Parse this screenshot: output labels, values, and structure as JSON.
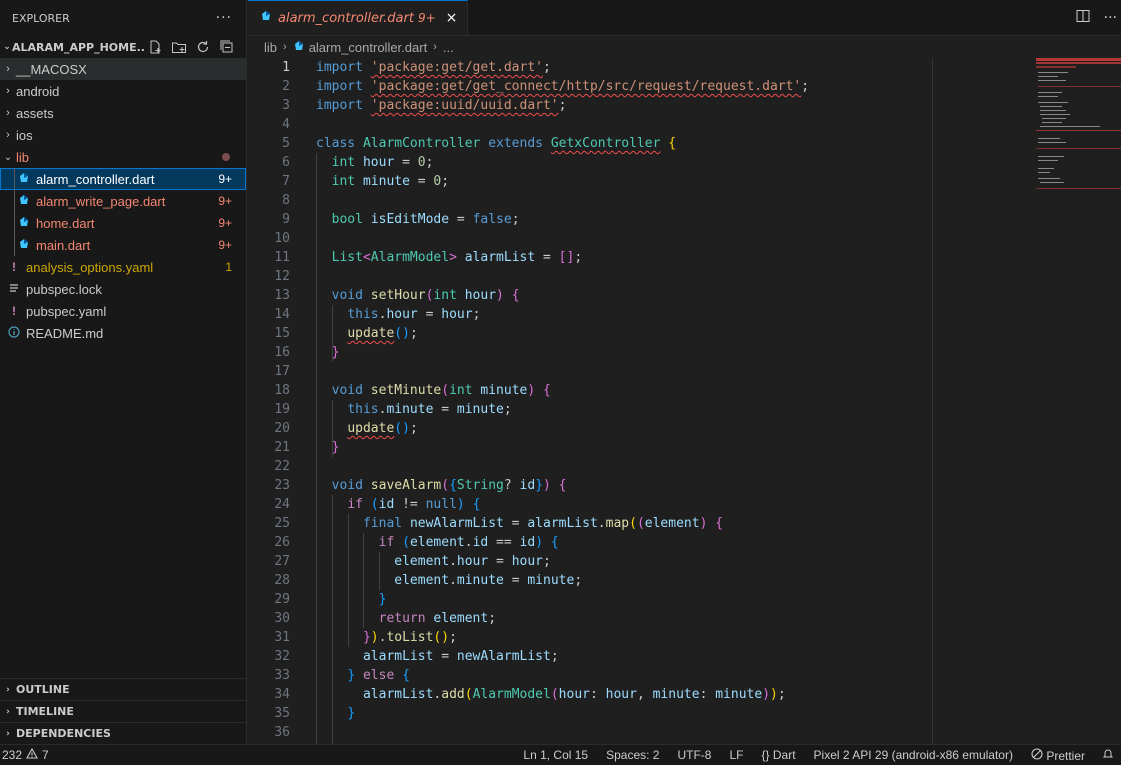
{
  "sidebar": {
    "header_title": "EXPLORER",
    "more": "···",
    "project_title": "ALARAM_APP_HOME...",
    "tree": [
      {
        "label": "__MACOSX",
        "type": "folder"
      },
      {
        "label": "android",
        "type": "folder"
      },
      {
        "label": "assets",
        "type": "folder"
      },
      {
        "label": "ios",
        "type": "folder"
      },
      {
        "label": "lib",
        "type": "folder-open"
      },
      {
        "label": "alarm_controller.dart",
        "badge": "9+"
      },
      {
        "label": "alarm_write_page.dart",
        "badge": "9+"
      },
      {
        "label": "home.dart",
        "badge": "9+"
      },
      {
        "label": "main.dart",
        "badge": "9+"
      },
      {
        "label": "analysis_options.yaml",
        "badge": "1"
      },
      {
        "label": "pubspec.lock"
      },
      {
        "label": "pubspec.yaml"
      },
      {
        "label": "README.md"
      }
    ],
    "sections": [
      "OUTLINE",
      "TIMELINE",
      "DEPENDENCIES"
    ]
  },
  "editor": {
    "tab_label": "alarm_controller.dart",
    "tab_badge": "9+",
    "tab_close": "×",
    "breadcrumb_folder": "lib",
    "breadcrumb_file": "alarm_controller.dart",
    "breadcrumb_more": "...",
    "line_numbers": [
      "1",
      "2",
      "3",
      "4",
      "5",
      "6",
      "7",
      "8",
      "9",
      "10",
      "11",
      "12",
      "13",
      "14",
      "15",
      "16",
      "17",
      "18",
      "19",
      "20",
      "21",
      "22",
      "23",
      "24",
      "25",
      "26",
      "27",
      "28",
      "29",
      "30",
      "31",
      "32",
      "33",
      "34",
      "35",
      "36"
    ]
  },
  "status": {
    "errors": "232",
    "warnings": "7",
    "position": "Ln 1, Col 15",
    "spaces": "Spaces: 2",
    "encoding": "UTF-8",
    "eol": "LF",
    "language": "Dart",
    "device": "Pixel 2 API 29 (android-x86 emulator)",
    "formatter": "Prettier"
  },
  "colors": {
    "accent": "#0078d4",
    "error": "#f48771",
    "warning": "#cca700",
    "dart": "#40c4ff"
  }
}
